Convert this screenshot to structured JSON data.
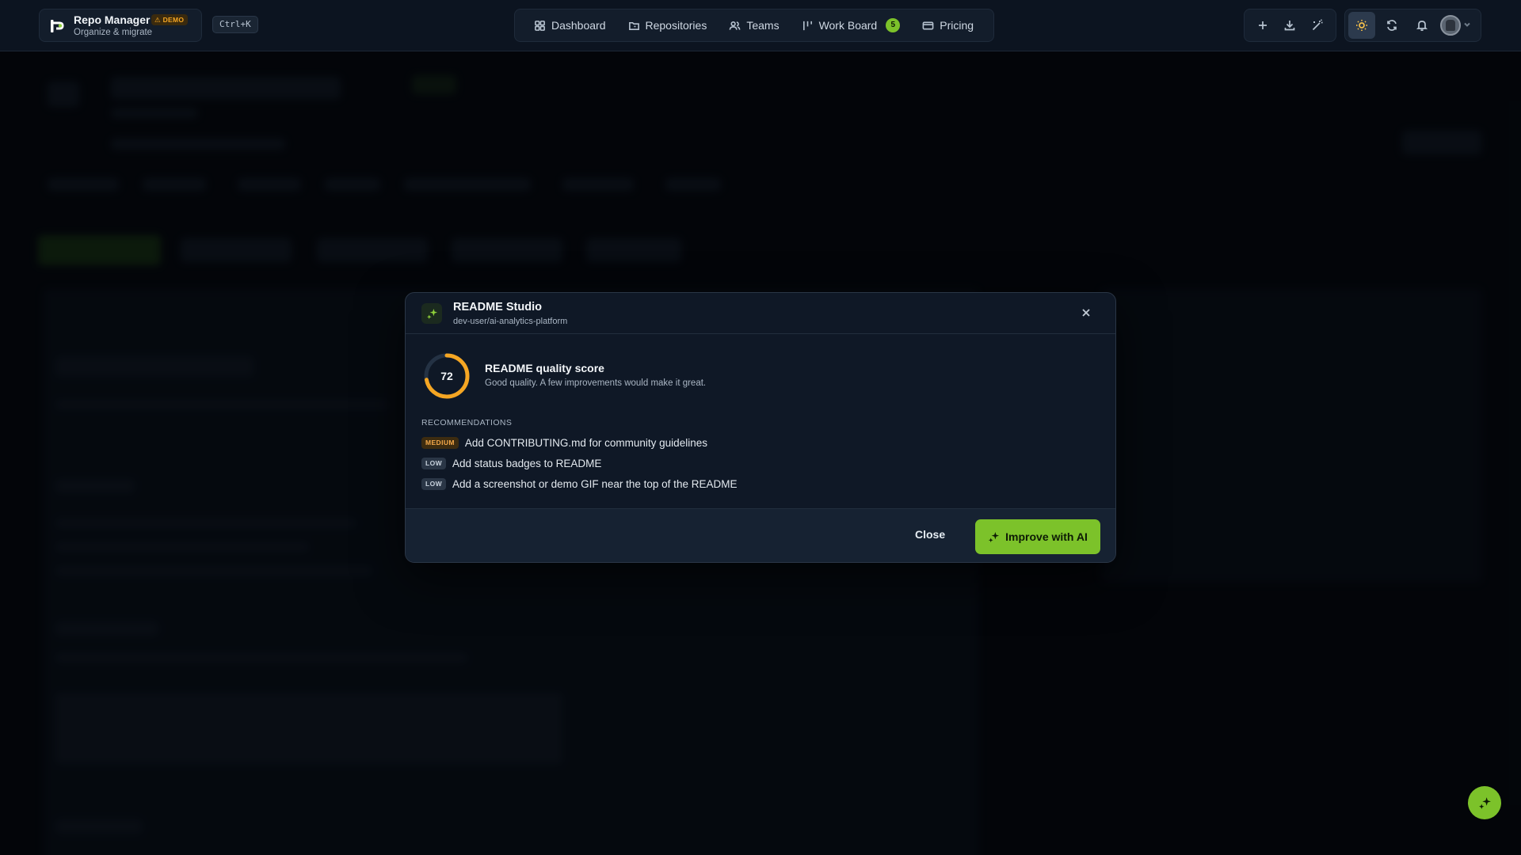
{
  "app": {
    "title": "Repo Manager",
    "badge": "⚠ DEMO",
    "subtitle": "Organize & migrate",
    "shortcut": "Ctrl+K"
  },
  "nav": {
    "items": [
      {
        "label": "Dashboard",
        "icon": "grid-icon"
      },
      {
        "label": "Repositories",
        "icon": "folder-icon"
      },
      {
        "label": "Teams",
        "icon": "users-icon"
      },
      {
        "label": "Work Board",
        "icon": "kanban-icon",
        "count": "5"
      },
      {
        "label": "Pricing",
        "icon": "credit-card-icon"
      }
    ]
  },
  "toolbar": {
    "icons": [
      "plus-icon",
      "download-icon",
      "magic-wand-icon",
      "sun-icon",
      "refresh-icon",
      "bell-icon",
      "avatar",
      "chevron-down-icon"
    ]
  },
  "modal": {
    "title": "README Studio",
    "subtitle": "dev-user/ai-analytics-platform",
    "score": {
      "value": "72",
      "fraction": 0.72,
      "title": "README quality score",
      "description": "Good quality. A few improvements would make it great."
    },
    "recommendations_heading": "RECOMMENDATIONS",
    "recommendations": [
      {
        "severity": "MEDIUM",
        "text": "Add CONTRIBUTING.md for community guidelines"
      },
      {
        "severity": "LOW",
        "text": "Add status badges to README"
      },
      {
        "severity": "LOW",
        "text": "Add a screenshot or demo GIF near the top of the README"
      }
    ],
    "close_label": "Close",
    "improve_label": "Improve with AI"
  },
  "colors": {
    "accent": "#7cc22a",
    "warning": "#f5a623",
    "background": "#05080d",
    "panel": "#0f1826"
  }
}
